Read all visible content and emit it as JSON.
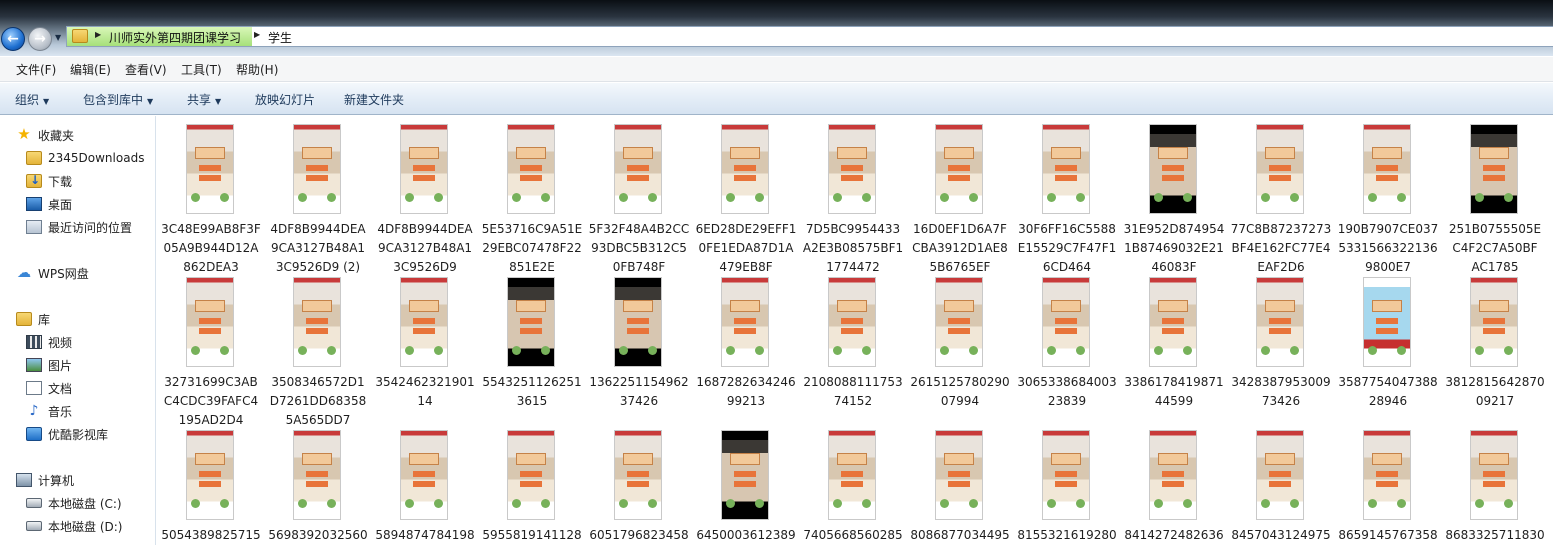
{
  "address": {
    "crumbs": [
      "川师实外第四期团课学习",
      "学生"
    ]
  },
  "menu": [
    "文件(F)",
    "编辑(E)",
    "查看(V)",
    "工具(T)",
    "帮助(H)"
  ],
  "commands": [
    {
      "label": "组织",
      "dropdown": true
    },
    {
      "label": "包含到库中",
      "dropdown": true
    },
    {
      "label": "共享",
      "dropdown": true
    },
    {
      "label": "放映幻灯片",
      "dropdown": false
    },
    {
      "label": "新建文件夹",
      "dropdown": false
    }
  ],
  "nav": {
    "favorites": {
      "label": "收藏夹",
      "items": [
        "2345Downloads",
        "下载",
        "桌面",
        "最近访问的位置"
      ]
    },
    "wps": "WPS网盘",
    "libraries": {
      "label": "库",
      "items": [
        "视频",
        "图片",
        "文档",
        "音乐",
        "优酷影视库"
      ]
    },
    "computer": {
      "label": "计算机",
      "items": [
        "本地磁盘 (C:)",
        "本地磁盘 (D:)"
      ]
    }
  },
  "files": [
    {
      "line1": "3C48E99AB8F3F",
      "line2": "05A9B944D12A",
      "line3": "862DEA3",
      "style": "normal"
    },
    {
      "line1": "4DF8B9944DEA",
      "line2": "9CA3127B48A1",
      "line3": "3C9526D9 (2)",
      "style": "normal"
    },
    {
      "line1": "4DF8B9944DEA",
      "line2": "9CA3127B48A1",
      "line3": "3C9526D9",
      "style": "normal"
    },
    {
      "line1": "5E53716C9A51E",
      "line2": "29EBC07478F22",
      "line3": "851E2E",
      "style": "normal"
    },
    {
      "line1": "5F32F48A4B2CC",
      "line2": "93DBC5B312C5",
      "line3": "0FB748F",
      "style": "normal"
    },
    {
      "line1": "6ED28DE29EFF1",
      "line2": "0FE1EDA87D1A",
      "line3": "479EB8F",
      "style": "normal"
    },
    {
      "line1": "7D5BC9954433",
      "line2": "A2E3B08575BF1",
      "line3": "1774472",
      "style": "normal"
    },
    {
      "line1": "16D0EF1D6A7F",
      "line2": "CBA3912D1AE8",
      "line3": "5B6765EF",
      "style": "normal"
    },
    {
      "line1": "30F6FF16C5588",
      "line2": "E15529C7F47F1",
      "line3": "6CD464",
      "style": "normal"
    },
    {
      "line1": "31E952D874954",
      "line2": "1B87469032E21",
      "line3": "46083F",
      "style": "dark"
    },
    {
      "line1": "77C8B87237273",
      "line2": "BF4E162FC77E4",
      "line3": "EAF2D6",
      "style": "normal"
    },
    {
      "line1": "190B7907CE037",
      "line2": "5331566322136",
      "line3": "9800E7",
      "style": "normal"
    },
    {
      "line1": "251B0755505E",
      "line2": "C4F2C7A50BF",
      "line3": "AC1785",
      "style": "dark"
    },
    {
      "line1": "32731699C3AB",
      "line2": "C4CDC39FAFC4",
      "line3": "195AD2D4",
      "style": "normal"
    },
    {
      "line1": "3508346572D1",
      "line2": "D7261DD68358",
      "line3": "5A565DD7",
      "style": "normal"
    },
    {
      "line1": "3542462321901",
      "line2": "14",
      "line3": "",
      "style": "normal"
    },
    {
      "line1": "5543251126251",
      "line2": "3615",
      "line3": "",
      "style": "dark"
    },
    {
      "line1": "1362251154962",
      "line2": "37426",
      "line3": "",
      "style": "dark"
    },
    {
      "line1": "1687282634246",
      "line2": "99213",
      "line3": "",
      "style": "normal"
    },
    {
      "line1": "2108088111753",
      "line2": "74152",
      "line3": "",
      "style": "normal"
    },
    {
      "line1": "2615125780290",
      "line2": "07994",
      "line3": "",
      "style": "normal"
    },
    {
      "line1": "3065338684003",
      "line2": "23839",
      "line3": "",
      "style": "normal"
    },
    {
      "line1": "3386178419871",
      "line2": "44599",
      "line3": "",
      "style": "normal"
    },
    {
      "line1": "3428387953009",
      "line2": "73426",
      "line3": "",
      "style": "normal"
    },
    {
      "line1": "3587754047388",
      "line2": "28946",
      "line3": "",
      "style": "alt"
    },
    {
      "line1": "3812815642870",
      "line2": "09217",
      "line3": "",
      "style": "normal"
    },
    {
      "line1": "5054389825715",
      "line2": "",
      "line3": "",
      "style": "normal"
    },
    {
      "line1": "5698392032560",
      "line2": "",
      "line3": "",
      "style": "normal"
    },
    {
      "line1": "5894874784198",
      "line2": "",
      "line3": "",
      "style": "normal"
    },
    {
      "line1": "5955819141128",
      "line2": "",
      "line3": "",
      "style": "normal"
    },
    {
      "line1": "6051796823458",
      "line2": "",
      "line3": "",
      "style": "normal"
    },
    {
      "line1": "6450003612389",
      "line2": "",
      "line3": "",
      "style": "dark"
    },
    {
      "line1": "7405668560285",
      "line2": "",
      "line3": "",
      "style": "normal"
    },
    {
      "line1": "8086877034495",
      "line2": "",
      "line3": "",
      "style": "normal"
    },
    {
      "line1": "8155321619280",
      "line2": "",
      "line3": "",
      "style": "normal"
    },
    {
      "line1": "8414272482636",
      "line2": "",
      "line3": "",
      "style": "normal"
    },
    {
      "line1": "8457043124975",
      "line2": "",
      "line3": "",
      "style": "normal"
    },
    {
      "line1": "8659145767358",
      "line2": "",
      "line3": "",
      "style": "normal"
    },
    {
      "line1": "8683325711830",
      "line2": "",
      "line3": "",
      "style": "normal"
    }
  ],
  "colors": {
    "accent": "#1e3a5c",
    "selection_green": "#a6e07a"
  }
}
